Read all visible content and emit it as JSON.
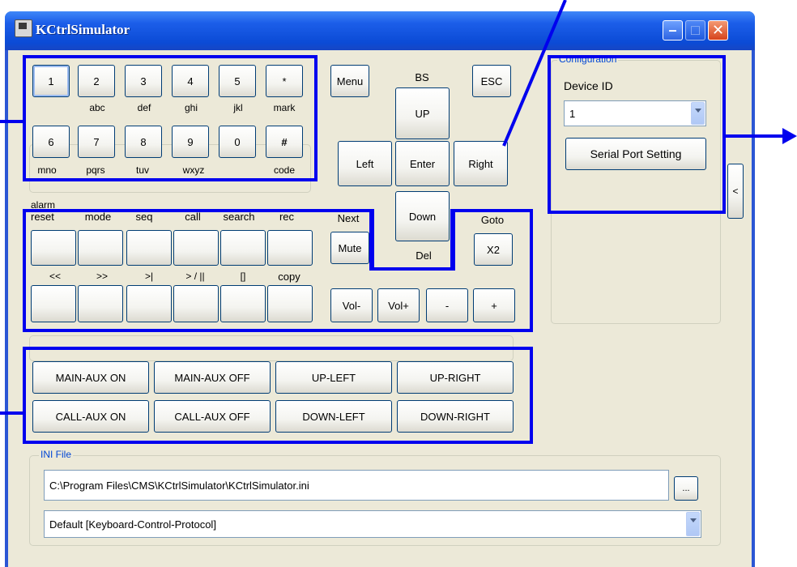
{
  "window": {
    "title": "KCtrlSimulator"
  },
  "keypad": {
    "row1": [
      "1",
      "2",
      "3",
      "4",
      "5",
      "*"
    ],
    "row1_sub": [
      "abc",
      "def",
      "ghi",
      "jkl",
      "mark"
    ],
    "row2": [
      "6",
      "7",
      "8",
      "9",
      "0",
      "#"
    ],
    "row2_sub": [
      "mno",
      "pqrs",
      "tuv",
      "wxyz",
      "code"
    ]
  },
  "nav": {
    "menu": "Menu",
    "bs": "BS",
    "esc": "ESC",
    "up": "UP",
    "left": "Left",
    "enter": "Enter",
    "right": "Right",
    "down": "Down",
    "del": "Del",
    "next": "Next",
    "mute": "Mute",
    "goto": "Goto",
    "x2": "X2",
    "vol_minus": "Vol-",
    "vol_plus": "Vol+",
    "minus": "-",
    "plus": "+"
  },
  "func": {
    "row1_labels": [
      "alarm",
      "reset",
      "mode",
      "seq",
      "call",
      "search",
      "rec"
    ],
    "row2_labels": [
      "<<",
      ">>",
      ">|",
      "> / ||",
      "[]",
      "copy"
    ]
  },
  "aux": {
    "row1": [
      "MAIN-AUX ON",
      "MAIN-AUX OFF",
      "UP-LEFT",
      "UP-RIGHT"
    ],
    "row2": [
      "CALL-AUX ON",
      "CALL-AUX OFF",
      "DOWN-LEFT",
      "DOWN-RIGHT"
    ]
  },
  "config": {
    "group": "Configuration",
    "device_label": "Device ID",
    "device_value": "1",
    "serial_button": "Serial Port Setting",
    "collapse": "<"
  },
  "ini": {
    "group": "INI File",
    "path": "C:\\Program Files\\CMS\\KCtrlSimulator\\KCtrlSimulator.ini",
    "browse": "...",
    "protocol": "Default [Keyboard-Control-Protocol]"
  }
}
